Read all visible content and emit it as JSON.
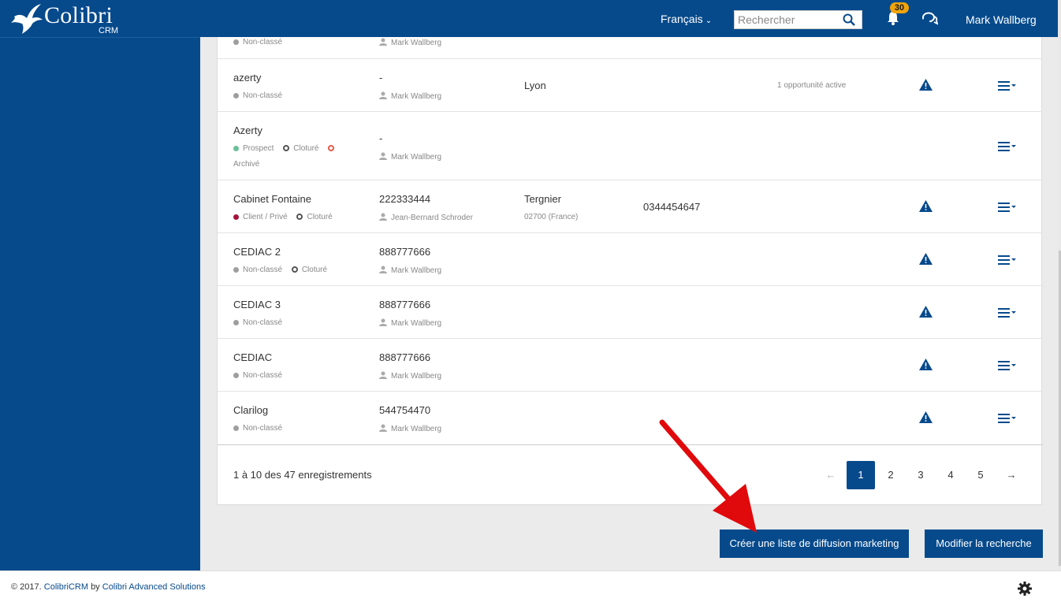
{
  "app": {
    "logo_name": "Colibri",
    "logo_sub": "CRM"
  },
  "header": {
    "language": "Français",
    "search_placeholder": "Rechercher",
    "notif_count": "30",
    "user_name": "Mark Wallberg"
  },
  "rows": [
    {
      "name": "",
      "tags": [
        "Non-classé"
      ],
      "siren": "",
      "owner": "Mark Wallberg",
      "city": "",
      "postal": "",
      "phone": "",
      "opp": ""
    },
    {
      "name": "azerty",
      "tags": [
        "Non-classé"
      ],
      "siren": "-",
      "owner": "Mark Wallberg",
      "city": "Lyon",
      "postal": "",
      "phone": "",
      "opp": "1 opportunité active"
    },
    {
      "name": "Azerty",
      "tags": [
        "Prospect",
        "Cloturé",
        "",
        "Archivé"
      ],
      "siren": "-",
      "owner": "Mark Wallberg",
      "city": "",
      "postal": "",
      "phone": "",
      "opp": ""
    },
    {
      "name": "Cabinet Fontaine",
      "tags": [
        "Client / Privé",
        "Cloturé"
      ],
      "siren": "222333444",
      "owner": "Jean-Bernard Schroder",
      "city": "Tergnier",
      "postal": "02700 (France)",
      "phone": "0344454647",
      "opp": ""
    },
    {
      "name": "CEDIAC 2",
      "tags": [
        "Non-classé",
        "Cloturé"
      ],
      "siren": "888777666",
      "owner": "Mark Wallberg",
      "city": "",
      "postal": "",
      "phone": "",
      "opp": ""
    },
    {
      "name": "CEDIAC 3",
      "tags": [
        "Non-classé"
      ],
      "siren": "888777666",
      "owner": "Mark Wallberg",
      "city": "",
      "postal": "",
      "phone": "",
      "opp": ""
    },
    {
      "name": "CEDIAC",
      "tags": [
        "Non-classé"
      ],
      "siren": "888777666",
      "owner": "Mark Wallberg",
      "city": "",
      "postal": "",
      "phone": "",
      "opp": ""
    },
    {
      "name": "Clarilog",
      "tags": [
        "Non-classé"
      ],
      "siren": "544754470",
      "owner": "Mark Wallberg",
      "city": "",
      "postal": "",
      "phone": "",
      "opp": ""
    }
  ],
  "pagination": {
    "summary": "1 à 10 des 47 enregistrements",
    "prev": "←",
    "next": "→",
    "pages": [
      "1",
      "2",
      "3",
      "4",
      "5"
    ]
  },
  "actions": {
    "create_list": "Créer une liste de diffusion marketing",
    "modify_search": "Modifier la recherche"
  },
  "footer": {
    "copyright": "© 2017.",
    "product_link": "ColibriCRM",
    "by": "by",
    "company_link": "Colibri Advanced Solutions"
  },
  "colors": {
    "primary": "#064a8c",
    "badge": "#f0a40c",
    "annotation_arrow": "#e0090b",
    "prospect": "#6ac09a",
    "client": "#a5123a",
    "archived_ring": "#e25b4a"
  }
}
